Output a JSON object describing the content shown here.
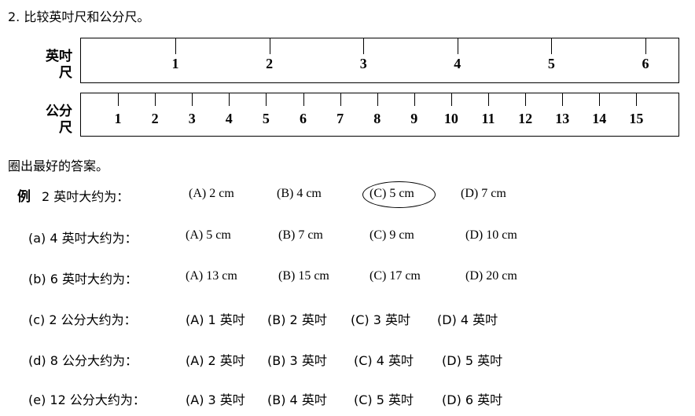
{
  "title": "2.  比较英吋尺和公分尺。",
  "inch_ruler": {
    "label_line1": "英吋",
    "label_line2": "尺",
    "numbers": [
      "1",
      "2",
      "3",
      "4",
      "5",
      "6"
    ]
  },
  "cm_ruler": {
    "label_line1": "公分",
    "label_line2": "尺",
    "numbers": [
      "1",
      "2",
      "3",
      "4",
      "5",
      "6",
      "7",
      "8",
      "9",
      "10",
      "11",
      "12",
      "13",
      "14",
      "15"
    ]
  },
  "instruction": "圈出最好的答案。",
  "example": {
    "tag": "例",
    "question": "2 英吋大约为：",
    "options": [
      "(A) 2 cm",
      "(B) 4 cm",
      "(C) 5 cm",
      "(D) 7 cm"
    ],
    "circled_option": "(C) 5 cm"
  },
  "questions": [
    {
      "label": "(a) 4 英吋大约为：",
      "options": [
        "(A) 5 cm",
        "(B) 7 cm",
        "(C) 9 cm",
        "(D) 10 cm"
      ]
    },
    {
      "label": "(b) 6 英吋大约为：",
      "options": [
        "(A) 13 cm",
        "(B) 15 cm",
        "(C) 17 cm",
        "(D) 20 cm"
      ]
    },
    {
      "label": "(c) 2 公分大约为：",
      "options": [
        "(A) 1 英吋",
        "(B) 2 英吋",
        "(C) 3 英吋",
        "(D) 4 英吋"
      ]
    },
    {
      "label": "(d) 8 公分大约为：",
      "options": [
        "(A) 2 英吋",
        "(B) 3 英吋",
        "(C) 4 英吋",
        "(D) 5 英吋"
      ]
    },
    {
      "label": "(e) 12 公分大约为：",
      "options": [
        "(A) 3 英吋",
        "(B) 4 英吋",
        "(C) 5 英吋",
        "(D) 6 英吋"
      ]
    }
  ]
}
